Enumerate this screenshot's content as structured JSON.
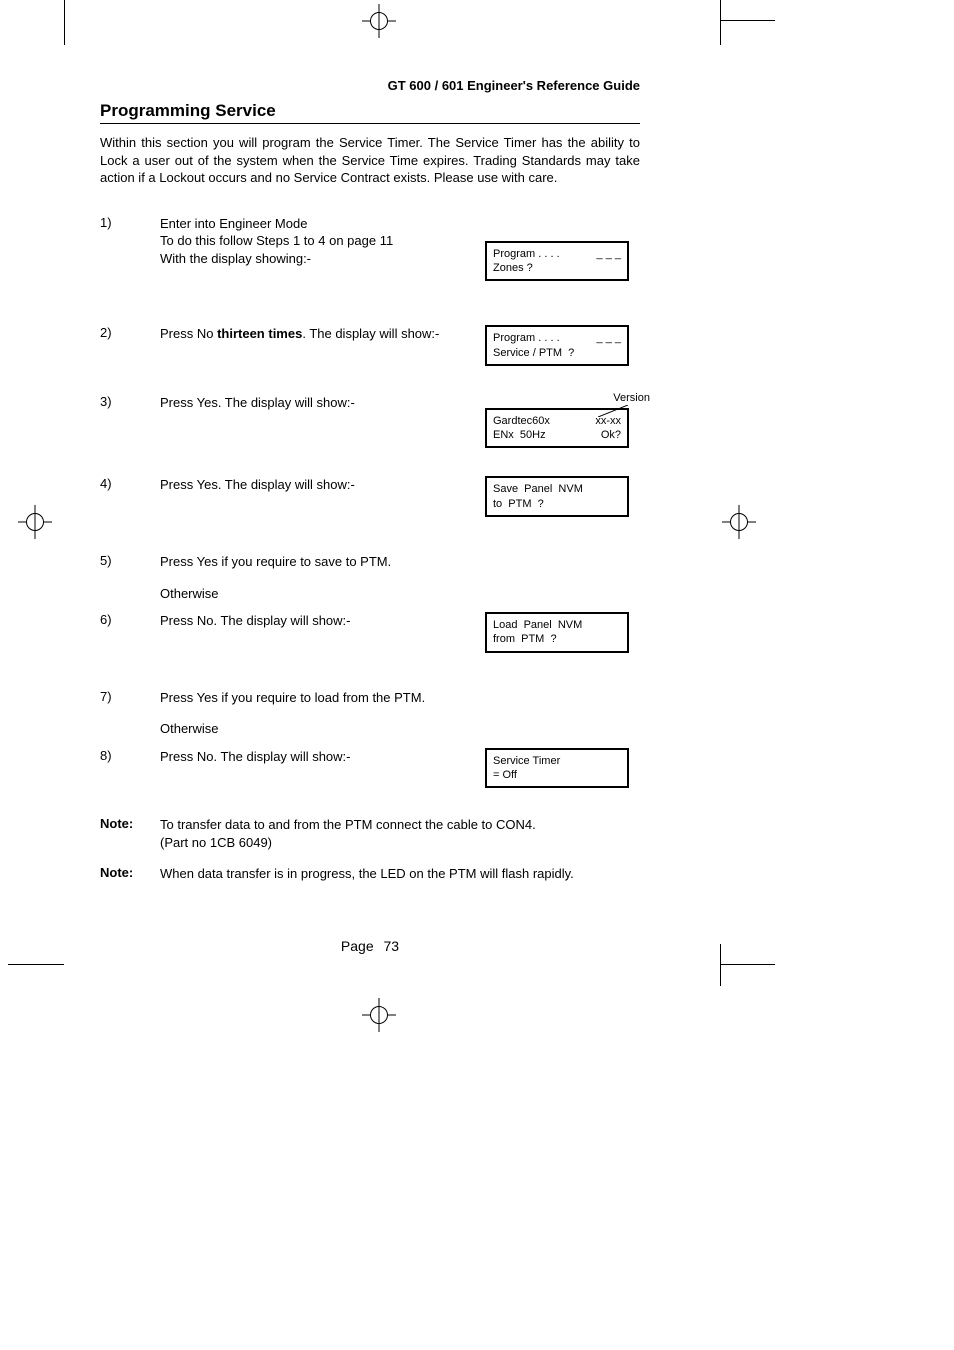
{
  "header": "GT 600 / 601 Engineer's Reference Guide",
  "title": "Programming Service",
  "intro": "Within this section you will program the Service Timer. The Service Timer has the ability to Lock a user out of the system when the Service Time expires. Trading Standards may take action if a Lockout occurs and no Service Contract exists. Please use with care.",
  "steps": {
    "s1": {
      "num": "1)",
      "l1": "Enter into Engineer Mode",
      "l2": "To do this follow Steps 1 to 4 on page 11",
      "l3": "With the display showing:-"
    },
    "s2": {
      "num": "2)",
      "text_a": "Press No ",
      "text_b": "thirteen times",
      "text_c": ". The display will show:-"
    },
    "s3": {
      "num": "3)",
      "text": "Press Yes. The display will show:-",
      "version_label": "Version"
    },
    "s4": {
      "num": "4)",
      "text": "Press Yes. The display will show:-"
    },
    "s5": {
      "num": "5)",
      "text": "Press Yes if you require to save to PTM.",
      "otherwise": "Otherwise"
    },
    "s6": {
      "num": "6)",
      "text": "Press No. The display will show:-"
    },
    "s7": {
      "num": "7)",
      "text": "Press Yes if you require to load from the PTM.",
      "otherwise": "Otherwise"
    },
    "s8": {
      "num": "8)",
      "text": "Press No. The display will show:-"
    }
  },
  "notes": {
    "label": "Note:",
    "n1l1": "To transfer data to and from the PTM connect the cable to CON4.",
    "n1l2": "(Part no 1CB 6049)",
    "n2": "When data transfer is in progress, the LED on the PTM will flash rapidly."
  },
  "lcd": {
    "d1": {
      "l1a": "Program . . . .",
      "l1b": "_ _ _",
      "l2": "Zones ?"
    },
    "d2": {
      "l1a": "Program . . . .",
      "l1b": "_ _ _",
      "l2": "Service / PTM  ?"
    },
    "d3": {
      "l1a": "Gardtec60x",
      "l1b": "xx-xx",
      "l2a": "ENx  50Hz",
      "l2b": "Ok?"
    },
    "d4": {
      "l1": "Save  Panel  NVM",
      "l2": "to  PTM  ?"
    },
    "d6": {
      "l1": "Load  Panel  NVM",
      "l2": "from  PTM  ?"
    },
    "d8": {
      "l1": "Service Timer",
      "l2": "= Off"
    }
  },
  "page": {
    "label": "Page",
    "number": "73"
  }
}
